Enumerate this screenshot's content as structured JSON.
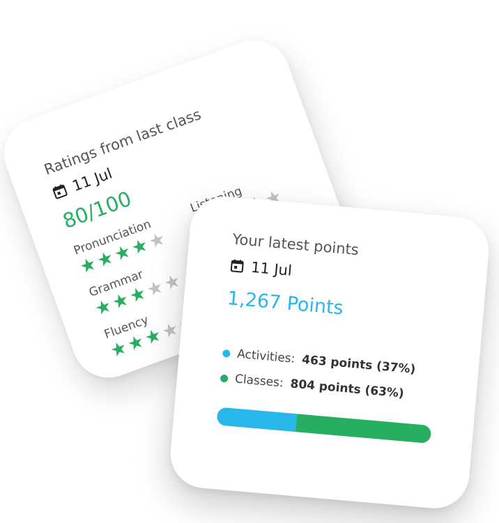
{
  "ratings_card": {
    "title": "Ratings from last class",
    "date": "11 Jul",
    "score": "80/100",
    "categories": [
      {
        "label": "Pronunciation",
        "stars": 4,
        "max": 5
      },
      {
        "label": "Listening",
        "stars": 4,
        "max": 5
      },
      {
        "label": "Grammar",
        "stars": 3,
        "max": 5
      },
      {
        "label": "Fluency",
        "stars": 3,
        "max": 5
      }
    ]
  },
  "points_card": {
    "title": "Your latest points",
    "date": "11 Jul",
    "total": "1,267 Points",
    "breakdown": [
      {
        "label": "Activities:",
        "value": "463 points (37%)",
        "percent": 37,
        "color": "#29b6e8"
      },
      {
        "label": "Classes:",
        "value": "804 points (63%)",
        "percent": 63,
        "color": "#27ae60"
      }
    ]
  },
  "icons": {
    "calendar": "calendar-icon",
    "star": "star-icon"
  },
  "colors": {
    "green": "#27ae60",
    "blue": "#29b6e8",
    "star_off": "#c2c2c2"
  }
}
